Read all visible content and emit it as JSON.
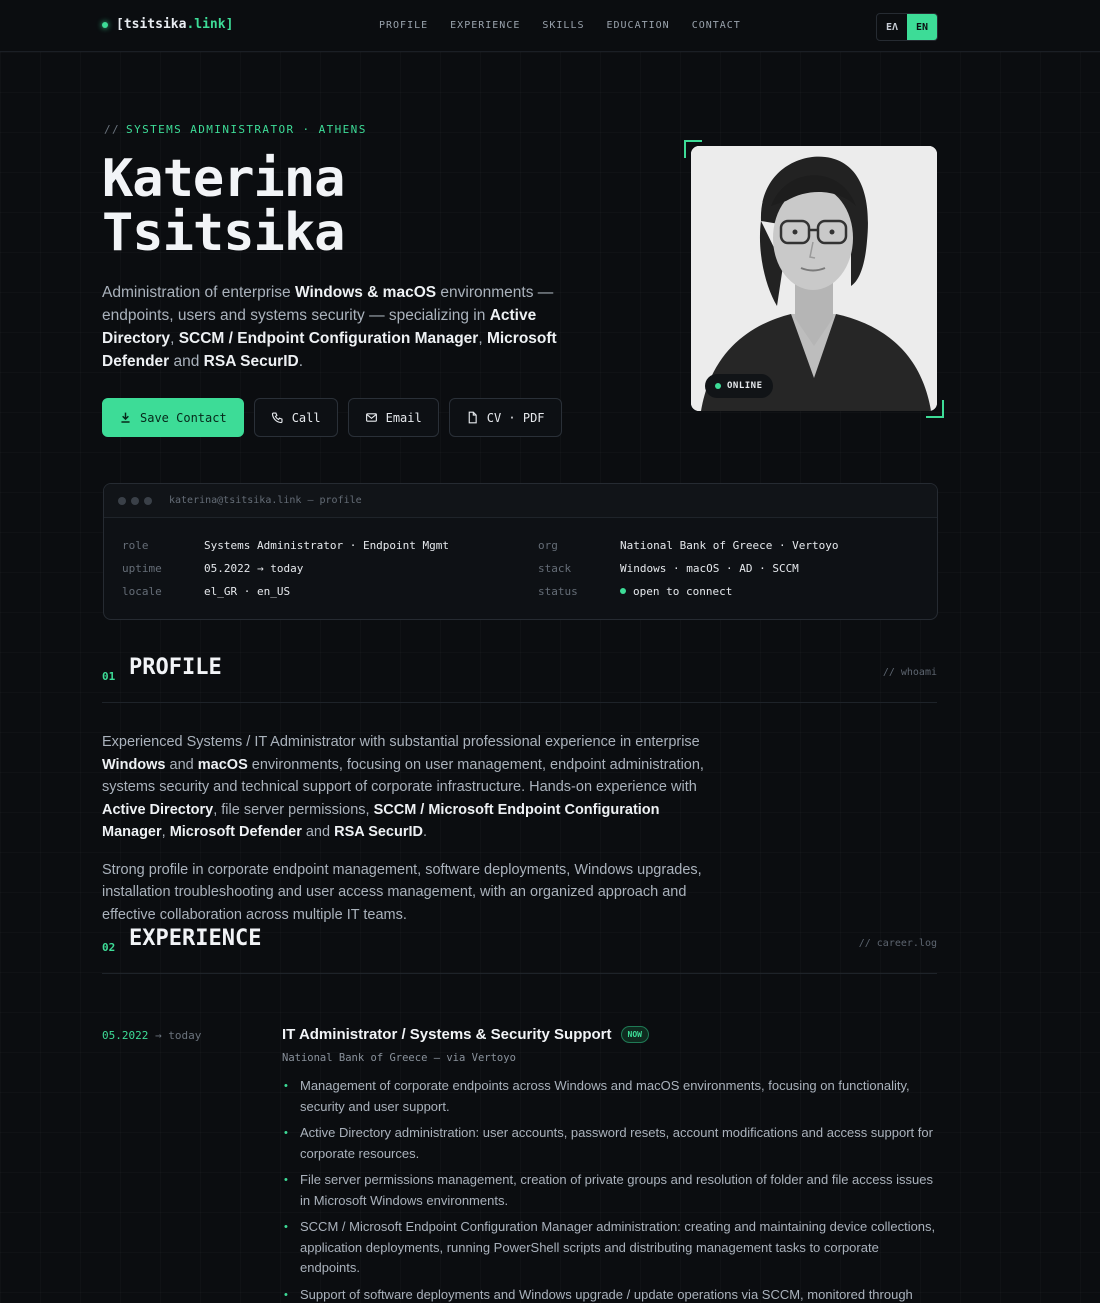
{
  "nav": {
    "logo_text": "[tsitsika",
    "logo_tld": ".link]",
    "links": [
      "PROFILE",
      "EXPERIENCE",
      "SKILLS",
      "EDUCATION",
      "CONTACT"
    ],
    "lang": [
      "EΛ",
      "EN"
    ],
    "lang_active": "EN"
  },
  "hero": {
    "eyebrow_prefix": "//",
    "eyebrow": "SYSTEMS ADMINISTRATOR · ATHENS",
    "first_name": "Katerina",
    "last_name": "Tsitsika",
    "desc": {
      "p1": "Administration of enterprise ",
      "b1": "Windows & macOS",
      "p2": " environments — endpoints, users and systems security — specializing in ",
      "b2": "Active Directory",
      "p3": ", ",
      "b3": "SCCM / Endpoint Configuration Manager",
      "p4": ", ",
      "b4": "Microsoft Defender",
      "p5": " and ",
      "b5": "RSA SecurID",
      "p6": "."
    },
    "buttons": {
      "save": "Save Contact",
      "call": "Call",
      "email": "Email",
      "cv": "CV · PDF"
    },
    "photo_badge": "ONLINE"
  },
  "terminal": {
    "title": "katerina@tsitsika.link — profile",
    "rows": [
      {
        "k1": "role",
        "v1": "Systems Administrator · Endpoint Mgmt",
        "k2": "org",
        "v2": "National Bank of Greece · Vertoyo"
      },
      {
        "k1": "uptime",
        "v1": "05.2022 → today",
        "k2": "stack",
        "v2": "Windows · macOS · AD · SCCM"
      },
      {
        "k1": "locale",
        "v1": "el_GR · en_US",
        "k2": "status",
        "v2": "open to connect"
      }
    ]
  },
  "profile": {
    "num": "01",
    "title": "PROFILE",
    "tag": "// whoami",
    "para1": {
      "a": "Experienced Systems / IT Administrator with substantial professional experience in enterprise ",
      "b1": "Windows",
      "c": " and ",
      "b2": "macOS",
      "d": " environments, focusing on user management, endpoint administration, systems security and technical support of corporate infrastructure. Hands-on experience with ",
      "b3": "Active Directory",
      "e": ", file server permissions, ",
      "b4": "SCCM / Microsoft Endpoint Configuration Manager",
      "f": ", ",
      "b5": "Microsoft Defender",
      "g": " and ",
      "b6": "RSA SecurID",
      "h": "."
    },
    "para2": "Strong profile in corporate endpoint management, software deployments, Windows upgrades, installation troubleshooting and user access management, with an organized approach and effective collaboration across multiple IT teams."
  },
  "experience": {
    "num": "02",
    "title": "EXPERIENCE",
    "tag": "// career.log",
    "job": {
      "date_from": "05.2022",
      "arrow": "→",
      "date_to": "today",
      "title": "IT Administrator / Systems & Security Support",
      "badge": "NOW",
      "org": "National Bank of Greece — via Vertoyo",
      "bullets": [
        "Management of corporate endpoints across Windows and macOS environments, focusing on functionality, security and user support.",
        "Active Directory administration: user accounts, password resets, account modifications and access support for corporate resources.",
        "File server permissions management, creation of private groups and resolution of folder and file access issues in Microsoft Windows environments.",
        "SCCM / Microsoft Endpoint Configuration Manager administration: creating and maintaining device collections, application deployments, running PowerShell scripts and distributing management tasks to corporate endpoints.",
        "Support of software deployments and Windows upgrade / update operations via SCCM, monitored through"
      ]
    }
  },
  "colors": {
    "accent": "#3ddc97",
    "background": "#0b0d10"
  }
}
